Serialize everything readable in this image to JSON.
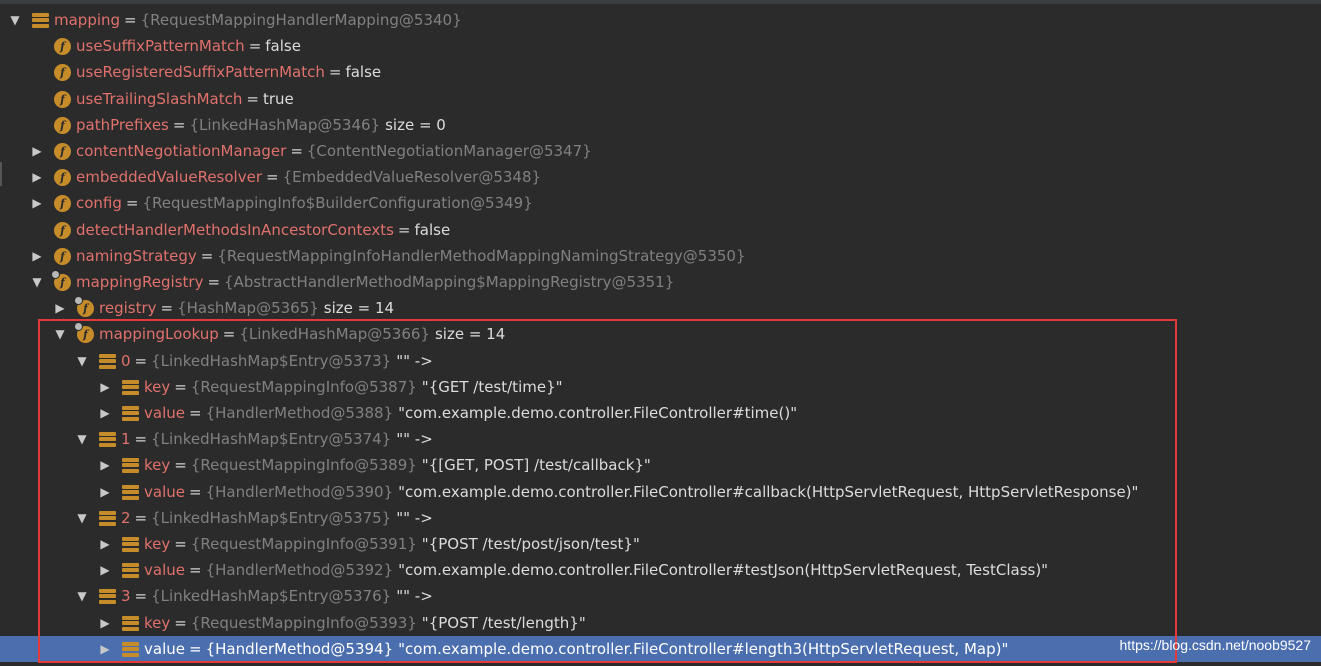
{
  "variables": [
    {
      "arrow": "down",
      "icon": "fields",
      "name": "mapping",
      "ref": "{RequestMappingHandlerMapping@5340}",
      "value": ""
    },
    {
      "arrow": "none",
      "icon": "f",
      "name": "useSuffixPatternMatch",
      "ref": "",
      "value": "false"
    },
    {
      "arrow": "none",
      "icon": "f",
      "name": "useRegisteredSuffixPatternMatch",
      "ref": "",
      "value": "false"
    },
    {
      "arrow": "none",
      "icon": "f",
      "name": "useTrailingSlashMatch",
      "ref": "",
      "value": "true"
    },
    {
      "arrow": "none",
      "icon": "f",
      "name": "pathPrefixes",
      "ref": "{LinkedHashMap@5346}",
      "value": "size = 0"
    },
    {
      "arrow": "right",
      "icon": "f",
      "name": "contentNegotiationManager",
      "ref": "{ContentNegotiationManager@5347}",
      "value": ""
    },
    {
      "arrow": "right",
      "icon": "f",
      "name": "embeddedValueResolver",
      "ref": "{EmbeddedValueResolver@5348}",
      "value": ""
    },
    {
      "arrow": "right",
      "icon": "f",
      "name": "config",
      "ref": "{RequestMappingInfo$BuilderConfiguration@5349}",
      "value": ""
    },
    {
      "arrow": "none",
      "icon": "f",
      "name": "detectHandlerMethodsInAncestorContexts",
      "ref": "",
      "value": "false"
    },
    {
      "arrow": "right",
      "icon": "f",
      "name": "namingStrategy",
      "ref": "{RequestMappingInfoHandlerMethodMappingNamingStrategy@5350}",
      "value": ""
    },
    {
      "arrow": "down",
      "icon": "f-locked",
      "name": "mappingRegistry",
      "ref": "{AbstractHandlerMethodMapping$MappingRegistry@5351}",
      "value": ""
    },
    {
      "arrow": "right",
      "icon": "f-locked",
      "name": "registry",
      "ref": "{HashMap@5365}",
      "value": "size = 14"
    },
    {
      "arrow": "down",
      "icon": "f-locked",
      "name": "mappingLookup",
      "ref": "{LinkedHashMap@5366}",
      "value": "size = 14"
    },
    {
      "arrow": "down",
      "icon": "fields",
      "name": "0",
      "ref": "{LinkedHashMap$Entry@5373}",
      "value": "\"\" ->"
    },
    {
      "arrow": "right",
      "icon": "fields",
      "name": "key",
      "ref": "{RequestMappingInfo@5387}",
      "value": "\"{GET /test/time}\""
    },
    {
      "arrow": "right",
      "icon": "fields",
      "name": "value",
      "ref": "{HandlerMethod@5388}",
      "value": "\"com.example.demo.controller.FileController#time()\""
    },
    {
      "arrow": "down",
      "icon": "fields",
      "name": "1",
      "ref": "{LinkedHashMap$Entry@5374}",
      "value": "\"\" ->"
    },
    {
      "arrow": "right",
      "icon": "fields",
      "name": "key",
      "ref": "{RequestMappingInfo@5389}",
      "value": "\"{[GET, POST] /test/callback}\""
    },
    {
      "arrow": "right",
      "icon": "fields",
      "name": "value",
      "ref": "{HandlerMethod@5390}",
      "value": "\"com.example.demo.controller.FileController#callback(HttpServletRequest, HttpServletResponse)\""
    },
    {
      "arrow": "down",
      "icon": "fields",
      "name": "2",
      "ref": "{LinkedHashMap$Entry@5375}",
      "value": "\"\" ->"
    },
    {
      "arrow": "right",
      "icon": "fields",
      "name": "key",
      "ref": "{RequestMappingInfo@5391}",
      "value": "\"{POST /test/post/json/test}\""
    },
    {
      "arrow": "right",
      "icon": "fields",
      "name": "value",
      "ref": "{HandlerMethod@5392}",
      "value": "\"com.example.demo.controller.FileController#testJson(HttpServletRequest, TestClass)\""
    },
    {
      "arrow": "down",
      "icon": "fields",
      "name": "3",
      "ref": "{LinkedHashMap$Entry@5376}",
      "value": "\"\" ->"
    },
    {
      "arrow": "right",
      "icon": "fields",
      "name": "key",
      "ref": "{RequestMappingInfo@5393}",
      "value": "\"{POST /test/length}\""
    },
    {
      "arrow": "right",
      "icon": "fields",
      "name": "value",
      "ref": "{HandlerMethod@5394}",
      "value": "\"com.example.demo.controller.FileController#length3(HttpServletRequest, Map)\"",
      "selected": true
    }
  ],
  "watermark": "https://blog.csdn.net/noob9527",
  "colors": {
    "background": "#2b2b2b",
    "field_name": "#e0716b",
    "reference": "#808080",
    "value": "#dcdcdc",
    "selection": "#4b6eaf",
    "icon": "#c78c2a",
    "highlight_box": "#e43a3a"
  }
}
